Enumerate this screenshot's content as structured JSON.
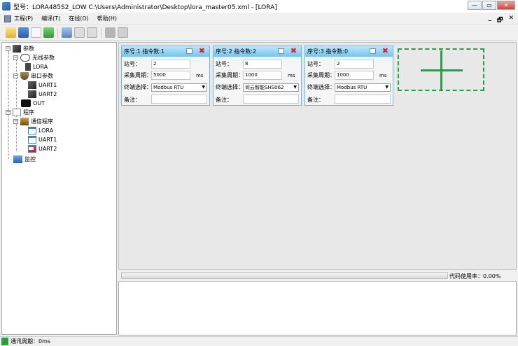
{
  "window": {
    "title": "型号：LORA485S2_LOW   C:\\Users\\Administrator\\Desktop\\lora_master05.xml - [LORA]",
    "btn_min": "—",
    "btn_max": "▭",
    "btn_close": "✕"
  },
  "menu": {
    "items": [
      "工程(P)",
      "编译(T)",
      "在线(O)",
      "帮助(H)"
    ],
    "mdi_min": "_",
    "mdi_restore": "🗗",
    "mdi_close": "✕"
  },
  "tree": {
    "root_params": "参数",
    "wireless_params": "无线参数",
    "lora": "LORA",
    "serial_params": "串口参数",
    "uart1": "UART1",
    "uart2": "UART2",
    "out": "OUT",
    "program": "程序",
    "comm_program": "通信程序",
    "prog_lora": "LORA",
    "prog_uart1": "UART1",
    "prog_uart2": "UART2",
    "monitor": "监控"
  },
  "labels": {
    "station": "站号：",
    "period": "采集周期：",
    "terminal": "终端选择：",
    "remark": "备注：",
    "unit_ms": "ms"
  },
  "cards": [
    {
      "header": "序号:1 指令数:1",
      "station": "2",
      "period": "5000",
      "terminal": "Modbus RTU",
      "remark": ""
    },
    {
      "header": "序号:2 指令数:2",
      "station": "8",
      "period": "1000",
      "terminal": "司云智能SHS062",
      "remark": ""
    },
    {
      "header": "序号:3 指令数:0",
      "station": "2",
      "period": "1000",
      "terminal": "Modbus RTU",
      "remark": ""
    }
  ],
  "progress": {
    "label": "代码使用率：0.00%",
    "value_percent": 0
  },
  "status": {
    "text": "通讯周期：0ms"
  },
  "colors": {
    "card_header": "#72c4ef",
    "add_card": "#22a04a",
    "delete": "#e02020",
    "status_ok": "#27a23b"
  }
}
